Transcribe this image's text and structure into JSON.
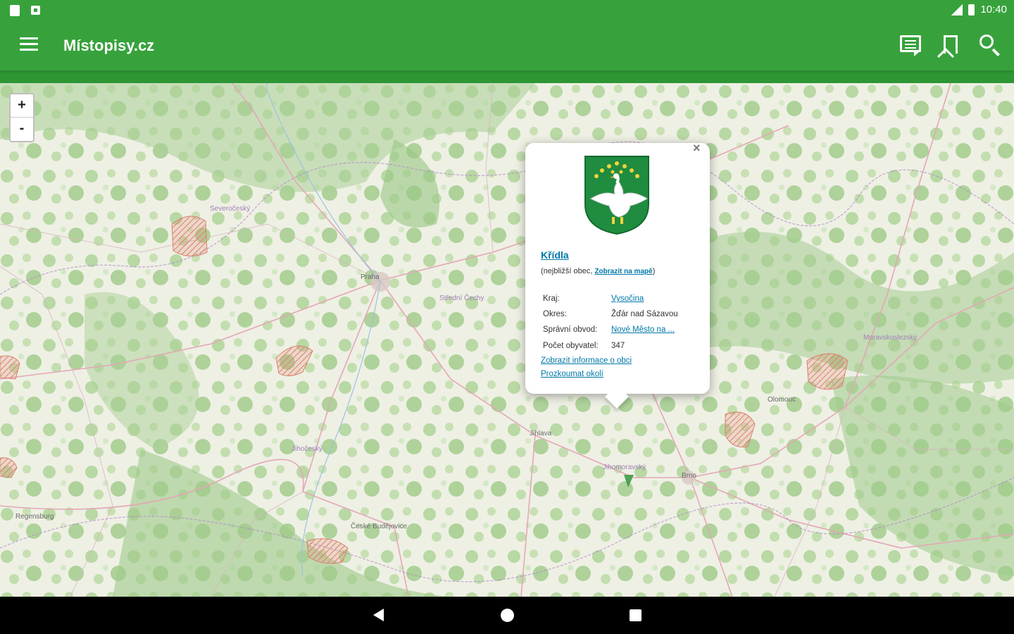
{
  "status_bar": {
    "time": "10:40"
  },
  "app_bar": {
    "title": "Místopisy.cz"
  },
  "map": {
    "zoom_in": "+",
    "zoom_out": "-",
    "labels": [
      {
        "text": "Severočeský",
        "cls": "lil"
      },
      {
        "text": "Praha",
        "cls": ""
      },
      {
        "text": "Střední Čechy",
        "cls": "lil"
      },
      {
        "text": "Jihočeský",
        "cls": "lil"
      },
      {
        "text": "České Budějovice",
        "cls": ""
      },
      {
        "text": "Jihomoravský",
        "cls": "lil"
      },
      {
        "text": "Brno",
        "cls": ""
      },
      {
        "text": "Moravskoslezský",
        "cls": "lil"
      },
      {
        "text": "Jihlava",
        "cls": ""
      },
      {
        "text": "Olomouc",
        "cls": ""
      },
      {
        "text": "Regensburg",
        "cls": ""
      }
    ]
  },
  "popup": {
    "close": "×",
    "name": "Křídla",
    "subtitle_prefix": "(nejbližší obec, ",
    "subtitle_link": "Zobrazit na mapě",
    "subtitle_suffix": ")",
    "rows": {
      "kraj_label": "Kraj:",
      "kraj_value": "Vysočina",
      "okres_label": "Okres:",
      "okres_value": "Žďár nad Sázavou",
      "obvod_label": "Správní obvod:",
      "obvod_value": "Nové Město na ...",
      "pocet_label": "Počet obyvatel:",
      "pocet_value": "347"
    },
    "link_info": "Zobrazit informace o obci",
    "link_explore": "Prozkoumat okolí"
  },
  "colors": {
    "appbar": "#37a23c",
    "link": "#0078a8"
  }
}
